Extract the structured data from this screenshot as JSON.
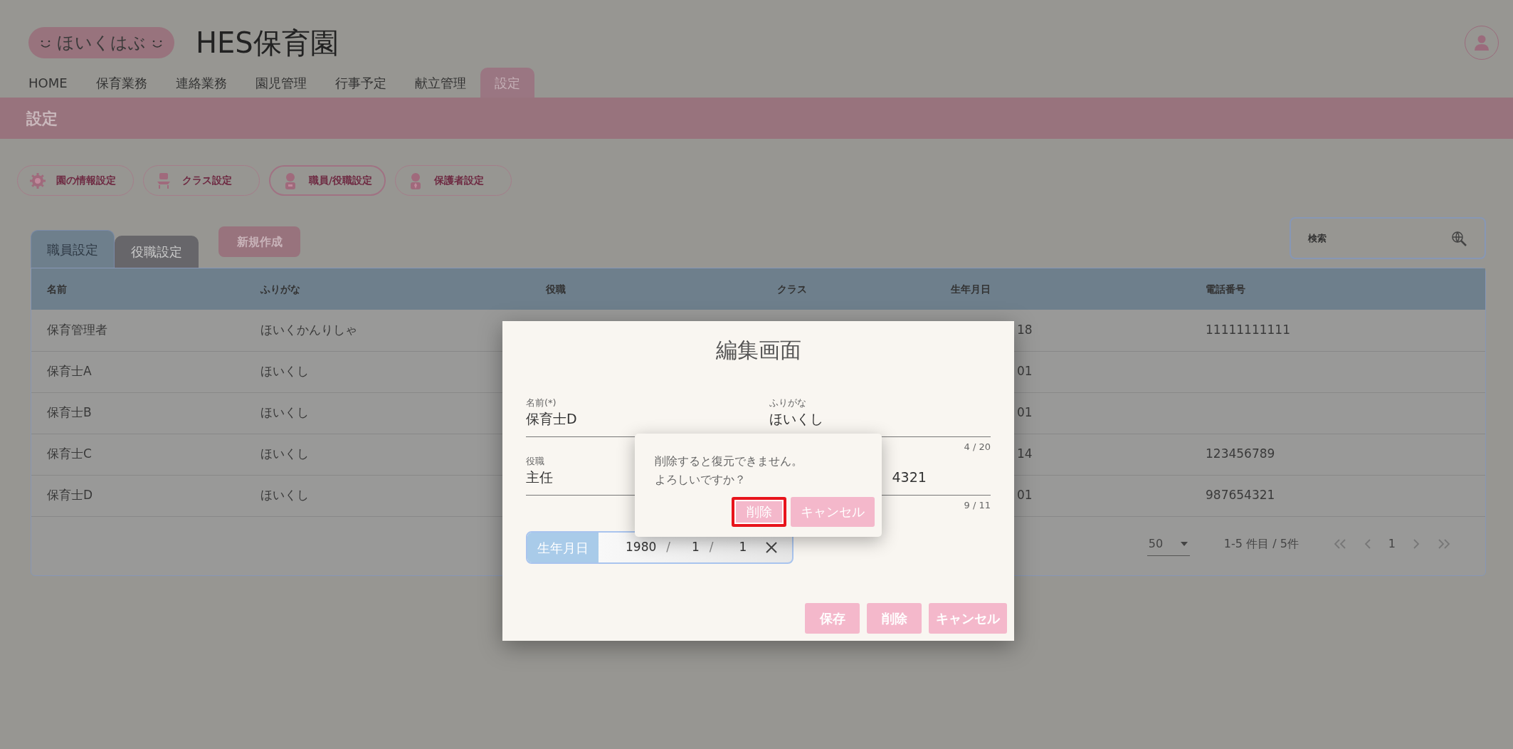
{
  "header": {
    "logo": "ほいくはぶ",
    "title": "HES保育園"
  },
  "nav": [
    {
      "label": "HOME",
      "selected": false
    },
    {
      "label": "保育業務",
      "selected": false
    },
    {
      "label": "連絡業務",
      "selected": false
    },
    {
      "label": "園児管理",
      "selected": false
    },
    {
      "label": "行事予定",
      "selected": false
    },
    {
      "label": "献立管理",
      "selected": false
    },
    {
      "label": "設定",
      "selected": true
    }
  ],
  "page_title": "設定",
  "settings_buttons": [
    {
      "label": "園の情報設定",
      "kind": "gear",
      "selected": false
    },
    {
      "label": "クラス設定",
      "kind": "chair",
      "selected": false
    },
    {
      "label": "職員/役職設定",
      "kind": "staff",
      "selected": true
    },
    {
      "label": "保護者設定",
      "kind": "guardian",
      "selected": false
    }
  ],
  "tabs": [
    {
      "label": "職員設定",
      "selected": true
    },
    {
      "label": "役職設定",
      "selected": false
    }
  ],
  "new_button": "新規作成",
  "search": {
    "placeholder": "検索"
  },
  "table": {
    "columns": [
      "名前",
      "ふりがな",
      "役職",
      "クラス",
      "生年月日",
      "電話番号"
    ],
    "rows": [
      {
        "name": "保育管理者",
        "furigana": "ほいくかんりしゃ",
        "birth_date": "18",
        "phone": "11111111111"
      },
      {
        "name": "保育士A",
        "furigana": "ほいくし",
        "birth_date": "01"
      },
      {
        "name": "保育士B",
        "furigana": "ほいくし",
        "birth_date": "01"
      },
      {
        "name": "保育士C",
        "furigana": "ほいくし",
        "birth_date": "14",
        "phone": "123456789"
      },
      {
        "name": "保育士D",
        "furigana": "ほいくし",
        "birth_date": "01",
        "phone": "987654321"
      }
    ]
  },
  "pagination": {
    "per_page": "50",
    "range": "1-5 件目 / 5件",
    "page": "1"
  },
  "edit_dialog": {
    "title": "編集画面",
    "fields": [
      {
        "label": "名前(*)",
        "value": "保育士D"
      },
      {
        "label": "ふりがな",
        "value": "ほいくし",
        "counter": "4 / 20"
      },
      {
        "label": "役職",
        "value": "主任"
      },
      {
        "value": "4321",
        "counter": "9 / 11"
      }
    ],
    "birth_date": {
      "label": "生年月日",
      "year": "1980",
      "month": "1",
      "day": "1",
      "separators": [
        "/",
        "/"
      ]
    },
    "buttons": [
      "保存",
      "削除",
      "キャンセル"
    ]
  },
  "confirm": {
    "message_lines": [
      "削除すると復元できません。",
      "よろしいですか？"
    ],
    "buttons": [
      {
        "label": "削除",
        "focused": true
      },
      {
        "label": "キャンセル",
        "focused": false
      }
    ]
  }
}
